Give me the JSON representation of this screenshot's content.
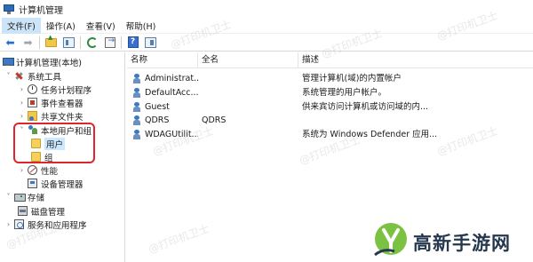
{
  "window": {
    "title": "计算机管理"
  },
  "menu": [
    "文件(F)",
    "操作(A)",
    "查看(V)",
    "帮助(H)"
  ],
  "toolbar": {
    "buttons": [
      "back-icon",
      "forward-icon",
      "up-folder-icon",
      "show-tree-icon",
      "refresh-icon",
      "export-icon",
      "help-icon",
      "action-pane-icon"
    ]
  },
  "tree": {
    "root": "计算机管理(本地)",
    "system_tools": "系统工具",
    "task_scheduler": "任务计划程序",
    "event_viewer": "事件查看器",
    "shared_folders": "共享文件夹",
    "local_users_groups": "本地用户和组",
    "users": "用户",
    "groups": "组",
    "performance": "性能",
    "device_manager": "设备管理器",
    "storage": "存储",
    "disk_management": "磁盘管理",
    "services_apps": "服务和应用程序"
  },
  "list": {
    "columns": [
      "名称",
      "全名",
      "描述"
    ],
    "rows": [
      {
        "name": "Administrat...",
        "fullname": "",
        "desc": "管理计算机(域)的内置帐户"
      },
      {
        "name": "DefaultAcc...",
        "fullname": "",
        "desc": "系统管理的用户帐户。"
      },
      {
        "name": "Guest",
        "fullname": "",
        "desc": "供来宾访问计算机或访问域的内..."
      },
      {
        "name": "QDRS",
        "fullname": "QDRS",
        "desc": ""
      },
      {
        "name": "WDAGUtilit...",
        "fullname": "",
        "desc": "系统为 Windows Defender 应用..."
      }
    ]
  },
  "watermark": "@打印机卫士",
  "brand": {
    "text": "高新手游网",
    "colors": {
      "green": "#7cc242",
      "dark": "#26384d"
    }
  },
  "colors": {
    "highlight": "#e0242c",
    "selection": "#cce8ff"
  }
}
